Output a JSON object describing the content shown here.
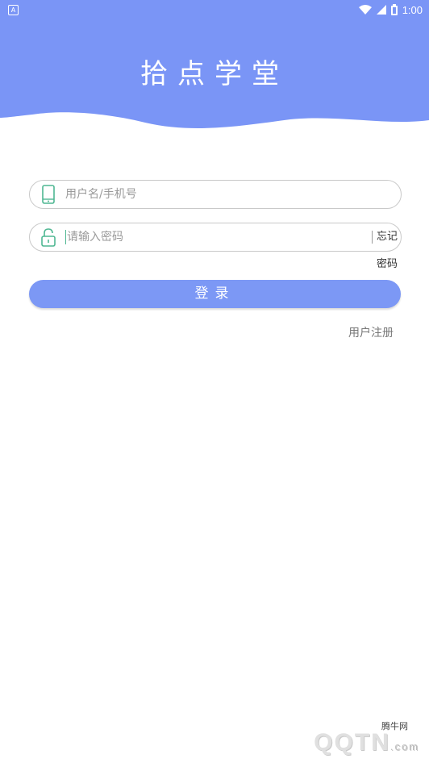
{
  "status_bar": {
    "time": "1:00",
    "notification_icon": "A"
  },
  "header": {
    "title": "拾点学堂",
    "color": "#7a95f6"
  },
  "username_field": {
    "placeholder": "用户名/手机号",
    "icon": "phone-icon"
  },
  "password_field": {
    "placeholder": "请输入密码",
    "icon": "unlock-icon",
    "forgot_label": "忘记密码"
  },
  "login_button": {
    "label": "登录",
    "color": "#7c98f5"
  },
  "register_link": {
    "label": "用户注册"
  },
  "watermark": {
    "text": "腾牛网",
    "logo": "QQTN",
    "suffix": ".com"
  }
}
